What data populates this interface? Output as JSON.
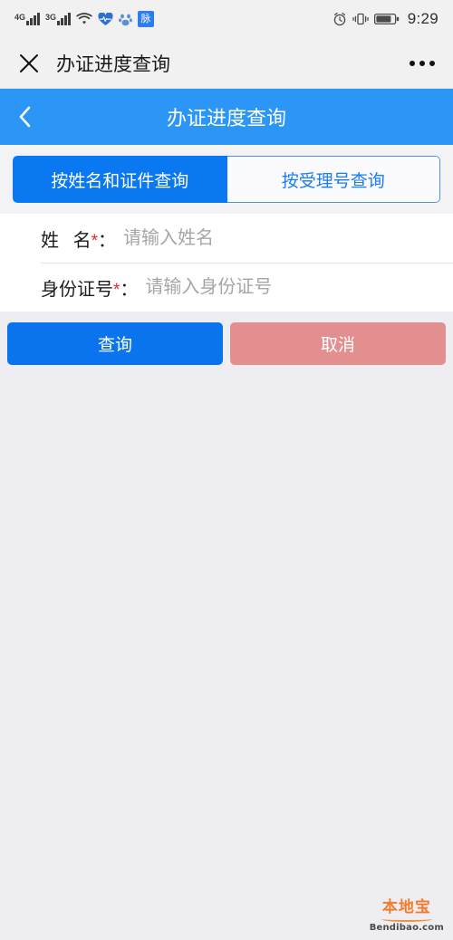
{
  "status_bar": {
    "network_4g": "4G",
    "network_3g": "3G",
    "wifi_icon": "wifi-icon",
    "heart_icon": "heart-icon",
    "paw_icon": "paw-icon",
    "app_badge": "脉",
    "alarm_icon": "alarm-icon",
    "vibrate_icon": "vibrate-icon",
    "battery_icon": "battery-icon",
    "time": "9:29"
  },
  "wechat_header": {
    "close_icon": "close-icon",
    "title": "办证进度查询",
    "more_icon": "more-options-icon"
  },
  "navbar": {
    "back_icon": "back-chevron-icon",
    "title": "办证进度查询"
  },
  "tabs": [
    {
      "label": "按姓名和证件查询",
      "active": true
    },
    {
      "label": "按受理号查询",
      "active": false
    }
  ],
  "form": {
    "fields": [
      {
        "label_main": "姓",
        "label_tail": "名",
        "required_mark": "*",
        "colon": "：",
        "value": "",
        "placeholder": "请输入姓名"
      },
      {
        "label_main": "身份证号",
        "label_tail": "",
        "required_mark": "*",
        "colon": "：",
        "value": "",
        "placeholder": "请输入身份证号"
      }
    ]
  },
  "actions": {
    "query_label": "查询",
    "cancel_label": "取消"
  },
  "watermark": {
    "cn": "本地宝",
    "en": "Bendibao.com"
  },
  "colors": {
    "navbar_blue": "#2b96f5",
    "tab_active_blue": "#0a78f0",
    "tab_inactive_text": "#1a7ef0",
    "button_query": "#0a74ef",
    "button_cancel": "#e48f8f",
    "required_red": "#e5262b",
    "page_bg": "#eeeef2",
    "watermark_orange": "#f07d2e"
  }
}
